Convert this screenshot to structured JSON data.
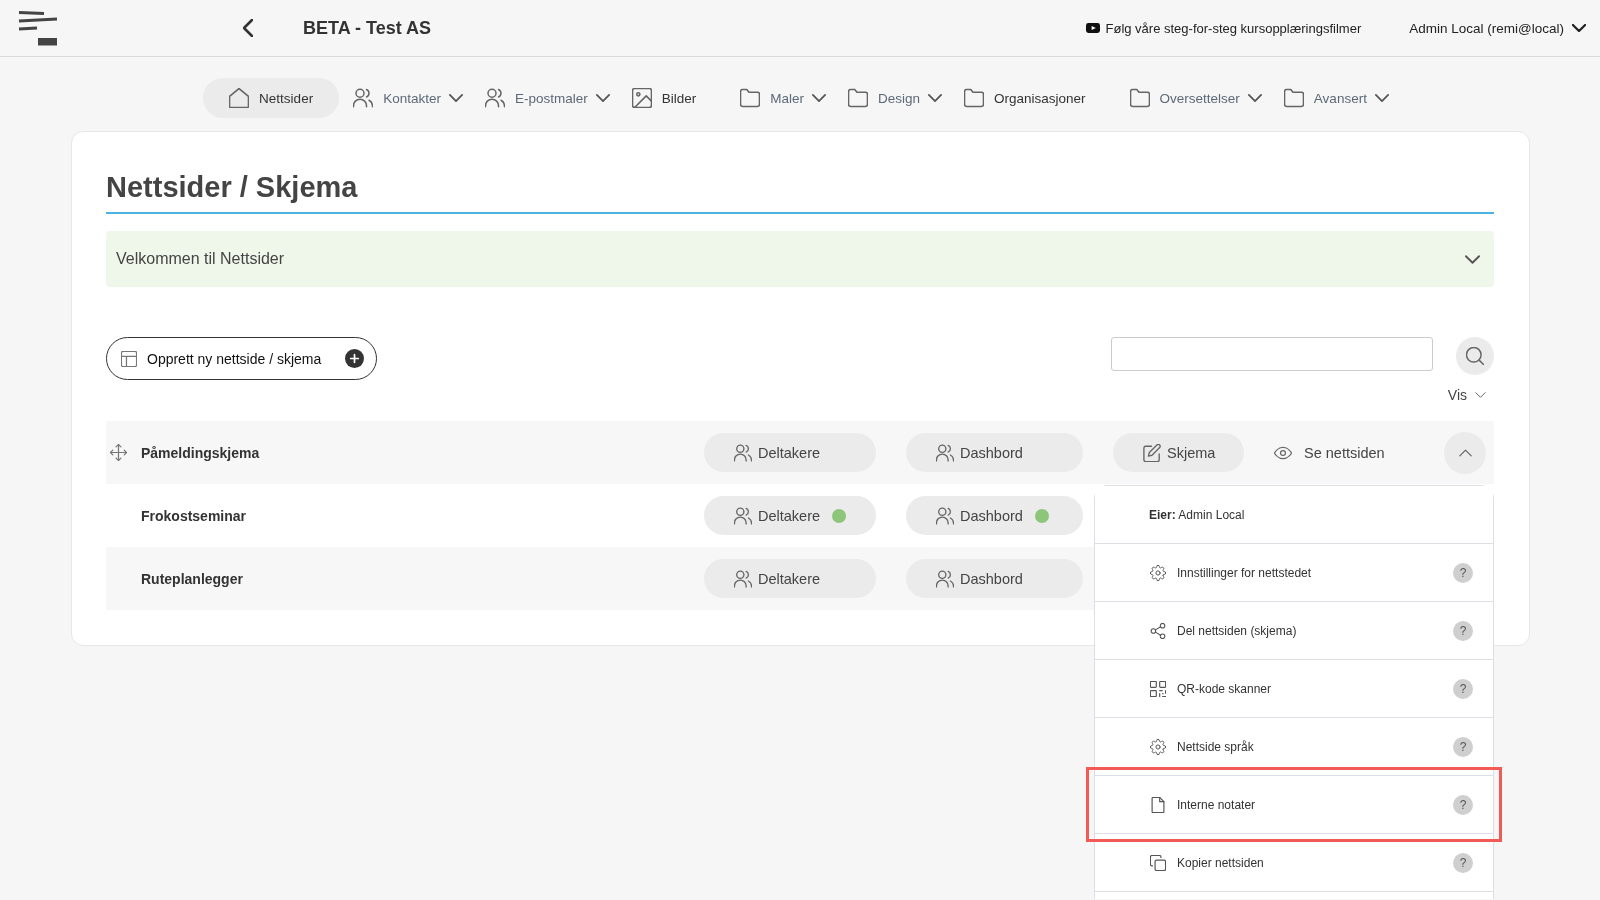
{
  "topbar": {
    "title": "BETA - Test AS",
    "tutorial_link": "Følg våre steg-for-steg kursopplæringsfilmer",
    "user": "Admin Local (remi@local)"
  },
  "nav": [
    {
      "label": "Nettsider",
      "kind": "link",
      "selected": true
    },
    {
      "label": "Kontakter",
      "kind": "menu",
      "selected": false
    },
    {
      "label": "E-postmaler",
      "kind": "menu",
      "selected": false
    },
    {
      "label": "Bilder",
      "kind": "link",
      "selected": false
    },
    {
      "label": "Maler",
      "kind": "menu",
      "selected": false
    },
    {
      "label": "Design",
      "kind": "menu",
      "selected": false
    },
    {
      "label": "Organisasjoner",
      "kind": "link",
      "selected": false
    },
    {
      "label": "Oversettelser",
      "kind": "menu",
      "selected": false
    },
    {
      "label": "Avansert",
      "kind": "menu",
      "selected": false
    }
  ],
  "page": {
    "title": "Nettsider / Skjema",
    "banner": {
      "text": "Velkommen til Nettsider",
      "expanded": false
    },
    "create_button": "Opprett ny nettside / skjema",
    "view_menu": "Vis"
  },
  "table": {
    "rows": [
      {
        "name": "Påmeldingskjema",
        "drag_handle": true,
        "expanded": true,
        "actions": [
          {
            "label": "Deltakere",
            "kind": "pill",
            "dot": false
          },
          {
            "label": "Dashbord",
            "kind": "pill",
            "dot": false
          },
          {
            "label": "Skjema",
            "kind": "pill",
            "dot": false
          },
          {
            "label": "Se nettsiden",
            "kind": "link",
            "dot": false
          }
        ],
        "menu": {
          "items": [
            {
              "kind": "owner",
              "label": "**Eier:** Admin Local",
              "highlighted": false
            },
            {
              "kind": "action",
              "label": "Innstillinger for nettstedet",
              "help": "?",
              "highlighted": false
            },
            {
              "kind": "action",
              "label": "Del nettsiden (skjema)",
              "help": "?",
              "highlighted": false
            },
            {
              "kind": "action",
              "label": "QR-kode skanner",
              "help": "?",
              "highlighted": false
            },
            {
              "kind": "action",
              "label": "Nettside språk",
              "help": "?",
              "highlighted": false
            },
            {
              "kind": "action",
              "label": "Interne notater",
              "help": "?",
              "highlighted": true
            },
            {
              "kind": "action",
              "label": "Kopier nettsiden",
              "help": "?",
              "highlighted": false
            }
          ]
        }
      },
      {
        "name": "Frokostseminar",
        "drag_handle": false,
        "actions": [
          {
            "label": "Deltakere",
            "kind": "pill",
            "dot": true
          },
          {
            "label": "Dashbord",
            "kind": "pill",
            "dot": true
          }
        ]
      },
      {
        "name": "Ruteplanlegger",
        "drag_handle": false,
        "actions": [
          {
            "label": "Deltakere",
            "kind": "pill",
            "dot": false
          },
          {
            "label": "Dashbord",
            "kind": "pill",
            "dot": false
          }
        ]
      }
    ]
  }
}
